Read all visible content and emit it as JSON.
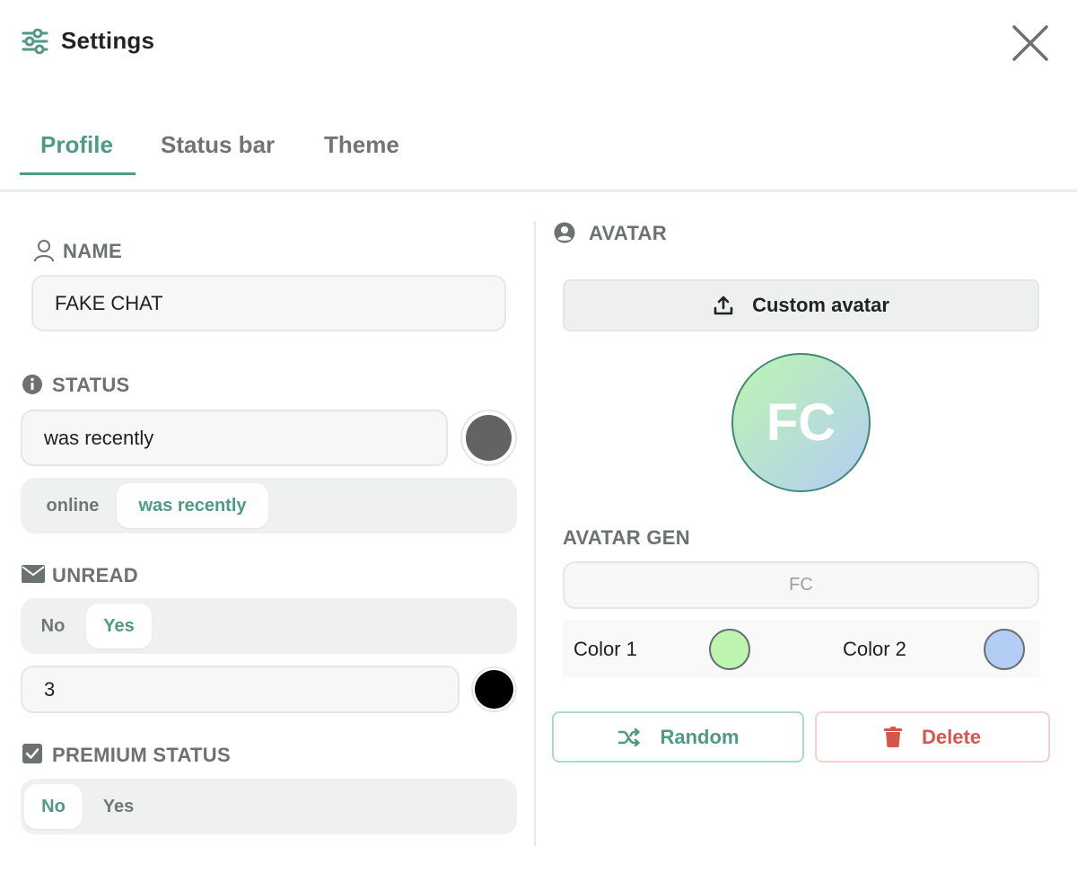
{
  "header": {
    "title": "Settings",
    "icon": "sliders-icon",
    "close_icon": "close-icon"
  },
  "tabs": [
    {
      "label": "Profile",
      "active": true
    },
    {
      "label": "Status bar",
      "active": false
    },
    {
      "label": "Theme",
      "active": false
    }
  ],
  "profile": {
    "name": {
      "label": "NAME",
      "icon": "person-icon",
      "value": "FAKE CHAT"
    },
    "status": {
      "label": "STATUS",
      "icon": "info-icon",
      "value": "was recently",
      "color": "#636363",
      "options": [
        {
          "label": "online",
          "selected": false
        },
        {
          "label": "was recently",
          "selected": true
        }
      ]
    },
    "unread": {
      "label": "UNREAD",
      "icon": "envelope-icon",
      "options": [
        {
          "label": "No",
          "selected": false
        },
        {
          "label": "Yes",
          "selected": true
        }
      ],
      "count": "3",
      "color": "#000000"
    },
    "premium": {
      "label": "PREMIUM STATUS",
      "icon": "checkbox-icon",
      "options": [
        {
          "label": "No",
          "selected": true
        },
        {
          "label": "Yes",
          "selected": false
        }
      ]
    }
  },
  "avatar": {
    "label": "AVATAR",
    "icon": "account-circle-icon",
    "custom_button": "Custom avatar",
    "custom_icon": "upload-icon",
    "initials": "FC",
    "gen_label": "AVATAR GEN",
    "gen_value": "FC",
    "color1_label": "Color 1",
    "color1": "#bdf5b0",
    "color2_label": "Color 2",
    "color2": "#b3cdf4",
    "random_button": "Random",
    "random_icon": "shuffle-icon",
    "delete_button": "Delete",
    "delete_icon": "trash-icon",
    "accent": "#4f9a86",
    "danger": "#d5564d"
  }
}
